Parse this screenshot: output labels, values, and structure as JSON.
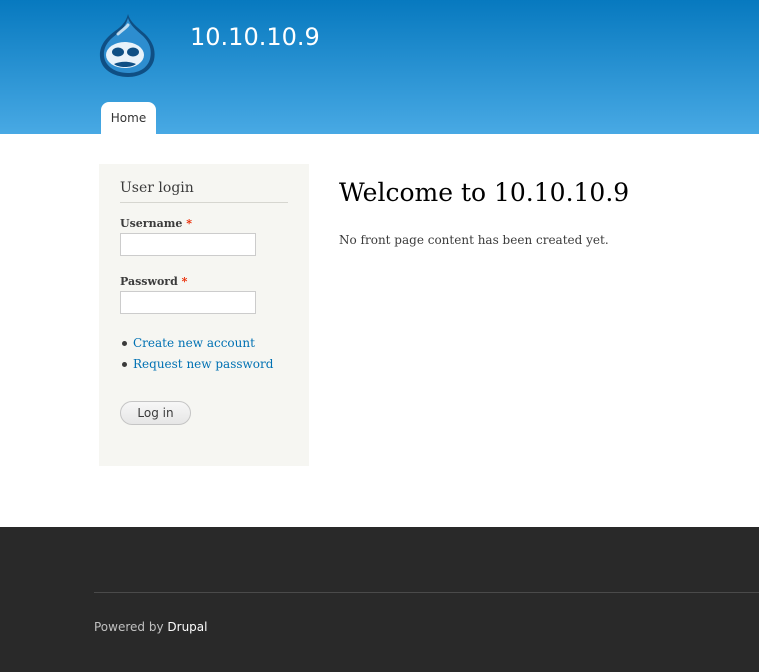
{
  "header": {
    "site_name": "10.10.10.9",
    "logo_icon": "drupal-drop-icon",
    "tabs": [
      {
        "label": "Home"
      }
    ]
  },
  "login_block": {
    "title": "User login",
    "username_label": "Username",
    "password_label": "Password",
    "required_marker": "*",
    "username_value": "",
    "password_value": "",
    "links": [
      {
        "label": "Create new account"
      },
      {
        "label": "Request new password"
      }
    ],
    "submit_label": "Log in"
  },
  "main": {
    "title": "Welcome to 10.10.10.9",
    "message": "No front page content has been created yet."
  },
  "footer": {
    "powered_prefix": "Powered by",
    "powered_link": "Drupal"
  },
  "colors": {
    "header_top": "#0779bf",
    "header_bottom": "#48a9e4",
    "link": "#0071b3",
    "footer_bg": "#292929",
    "required": "#ea2800"
  }
}
